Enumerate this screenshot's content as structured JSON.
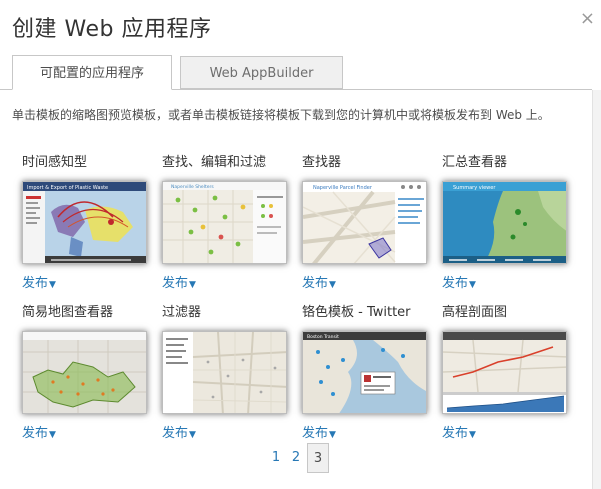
{
  "dialog": {
    "title": "创建 Web 应用程序",
    "close_glyph": "×"
  },
  "tabs": [
    {
      "label": "可配置的应用程序",
      "active": true
    },
    {
      "label": "Web AppBuilder",
      "active": false
    }
  ],
  "description": "单击模板的缩略图预览模板，或者单击模板链接将模板下载到您的计算机中或将模板发布到 Web 上。",
  "publish_label": "发布",
  "caret_glyph": "▼",
  "templates": [
    {
      "name": "时间感知型",
      "thumbnail": "time-aware-thumbnail",
      "thumb_title": "Import & Export of Plastic Waste"
    },
    {
      "name": "查找、编辑和过滤",
      "thumbnail": "find-edit-filter-thumbnail",
      "thumb_title": "Naperville Shelters"
    },
    {
      "name": "查找器",
      "thumbnail": "finder-thumbnail",
      "thumb_title": "Naperville Parcel Finder"
    },
    {
      "name": "汇总查看器",
      "thumbnail": "summary-viewer-thumbnail",
      "thumb_title": "Summary viewer"
    },
    {
      "name": "简易地图查看器",
      "thumbnail": "basic-viewer-thumbnail",
      "thumb_title": ""
    },
    {
      "name": "过滤器",
      "thumbnail": "filter-thumbnail",
      "thumb_title": ""
    },
    {
      "name": "铬色模板 - Twitter",
      "thumbnail": "chrome-twitter-thumbnail",
      "thumb_title": "Boston Transit"
    },
    {
      "name": "高程剖面图",
      "thumbnail": "elevation-profile-thumbnail",
      "thumb_title": ""
    }
  ],
  "pagination": {
    "pages": [
      "1",
      "2",
      "3"
    ],
    "current": "3"
  },
  "colors": {
    "link": "#2778b5",
    "tab_border": "#c7c7c7",
    "inactive_tab_bg": "#f0f0f0"
  }
}
